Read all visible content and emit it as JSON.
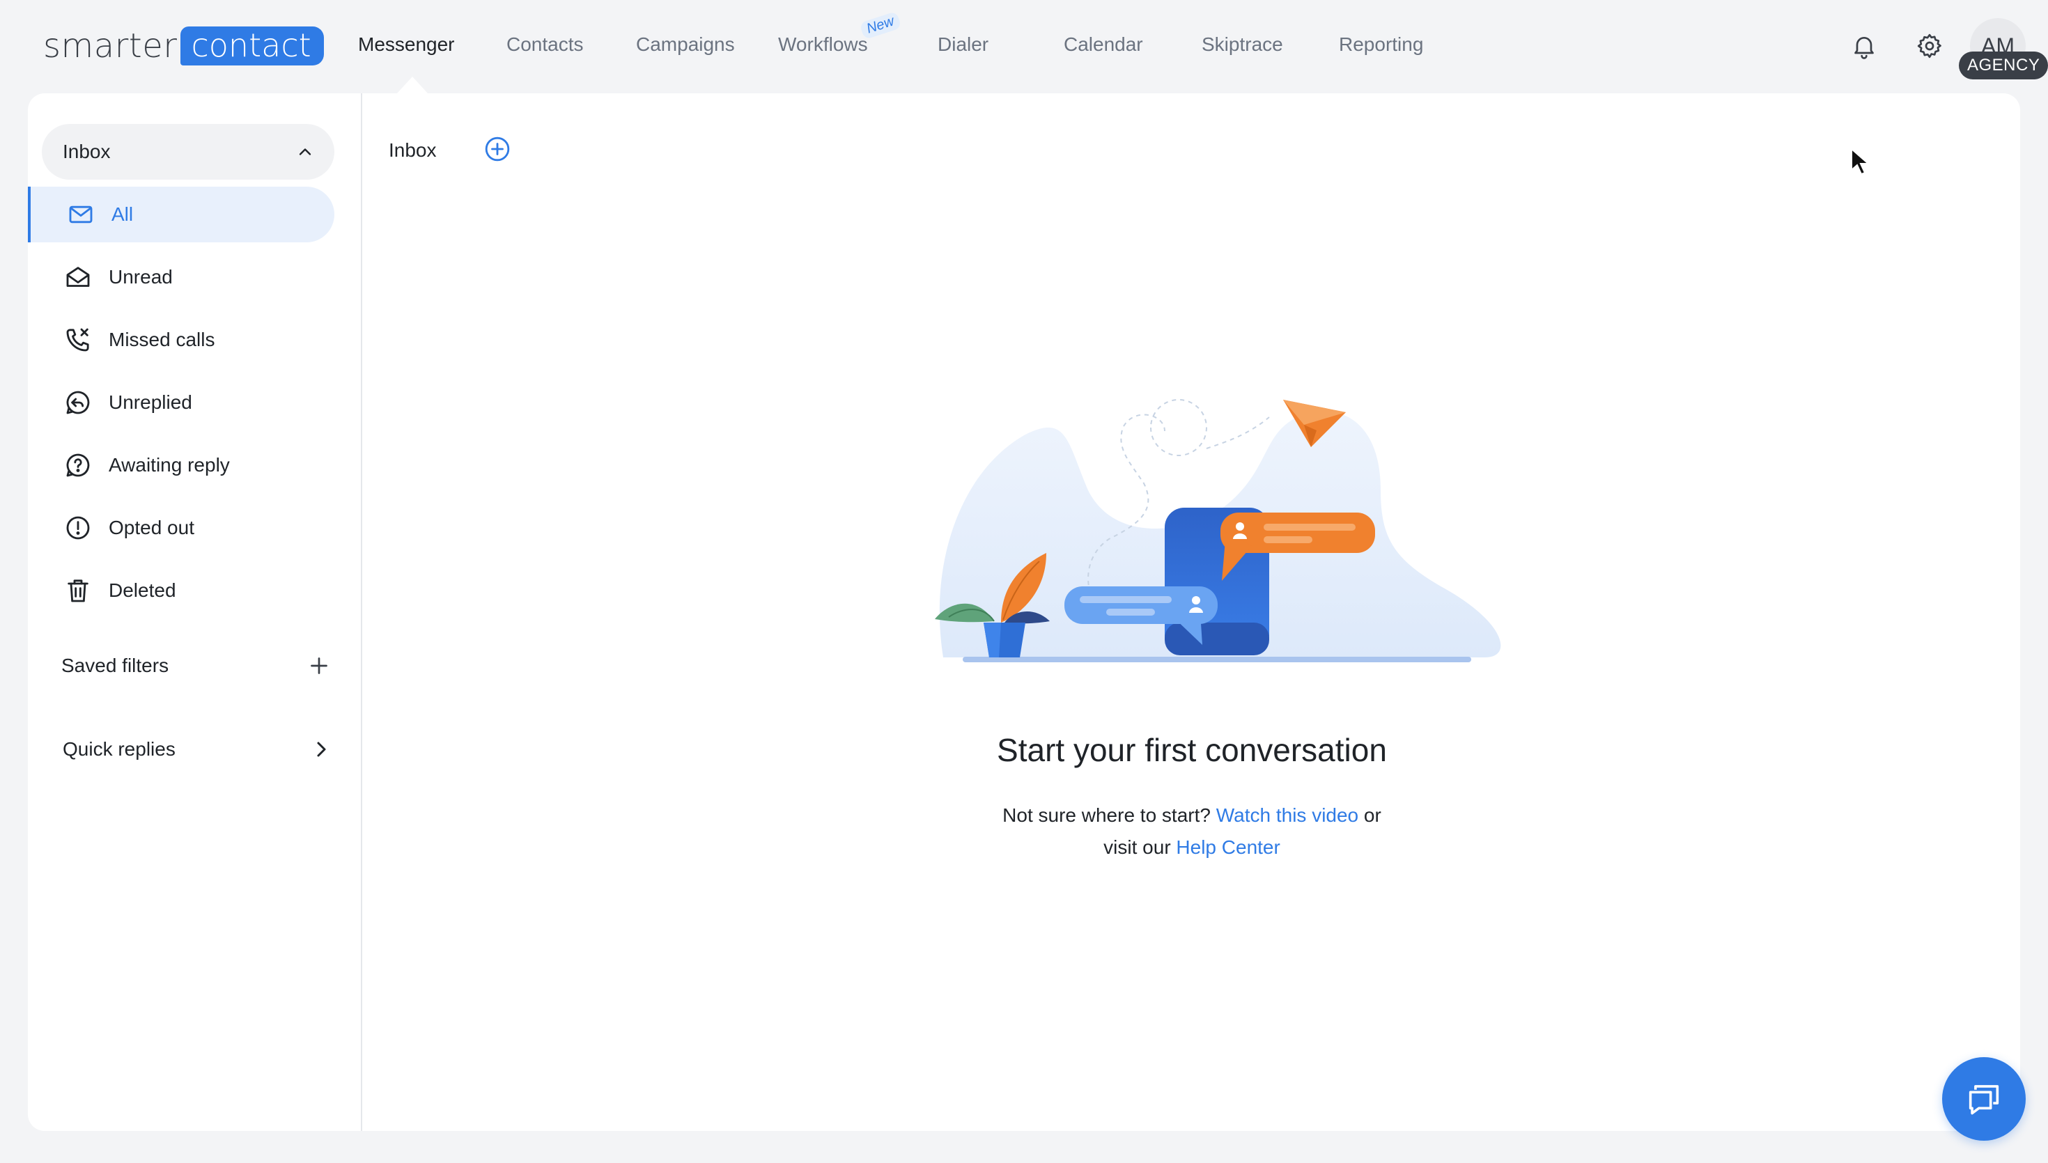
{
  "brand": {
    "logo_left": "smarter",
    "logo_right": "contact"
  },
  "nav": {
    "items": [
      {
        "label": "Messenger",
        "active": true
      },
      {
        "label": "Contacts"
      },
      {
        "label": "Campaigns"
      },
      {
        "label": "Workflows",
        "badge": "New"
      },
      {
        "label": "Dialer"
      },
      {
        "label": "Calendar"
      },
      {
        "label": "Skiptrace"
      },
      {
        "label": "Reporting"
      }
    ]
  },
  "header_icons": {
    "notifications": "bell-icon",
    "settings": "gear-icon"
  },
  "user": {
    "initials": "AM",
    "badge": "AGENCY"
  },
  "sidebar": {
    "inbox_label": "Inbox",
    "folders": [
      {
        "label": "All",
        "icon": "envelope-icon",
        "active": true
      },
      {
        "label": "Unread",
        "icon": "open-envelope-icon"
      },
      {
        "label": "Missed calls",
        "icon": "missed-call-icon"
      },
      {
        "label": "Unreplied",
        "icon": "reply-bubble-icon"
      },
      {
        "label": "Awaiting reply",
        "icon": "question-bubble-icon"
      },
      {
        "label": "Opted out",
        "icon": "exclamation-circle-icon"
      },
      {
        "label": "Deleted",
        "icon": "trash-icon"
      }
    ],
    "saved_filters_label": "Saved filters",
    "quick_replies_label": "Quick replies"
  },
  "content": {
    "title": "Inbox",
    "empty_title": "Start your first conversation",
    "empty_line1_prefix": "Not sure where to start?",
    "empty_link_video": "Watch this video",
    "empty_line1_suffix": "or",
    "empty_line2_prefix": "visit our",
    "empty_link_help": "Help Center"
  },
  "colors": {
    "accent": "#2f7be5",
    "orange": "#f0812e",
    "text": "#1f2328",
    "muted": "#6b7380"
  }
}
